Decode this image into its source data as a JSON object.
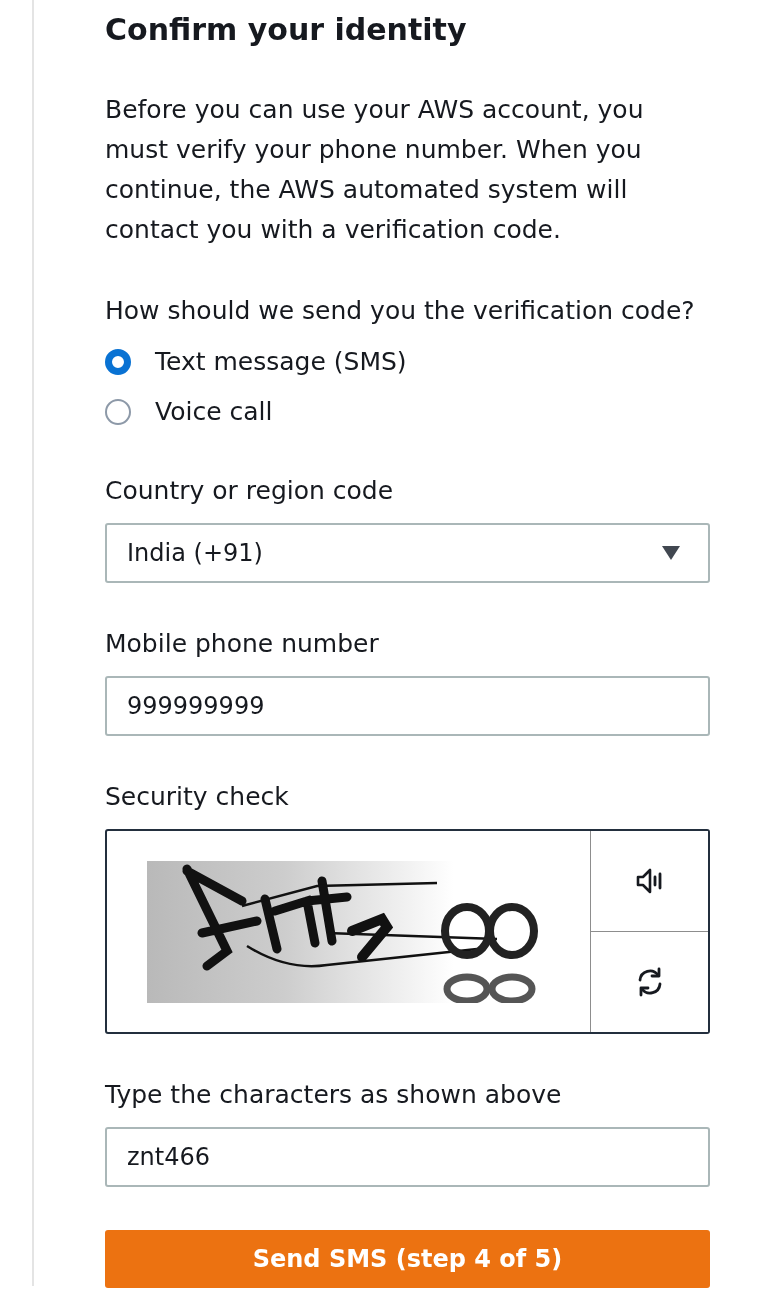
{
  "page": {
    "title": "Confirm your identity",
    "intro": "Before you can use your AWS account, you must verify your phone number. When you continue, the AWS automated system will contact you with a verification code."
  },
  "delivery": {
    "label": "How should we send you the verification code?",
    "options": [
      {
        "label": "Text message (SMS)",
        "selected": true
      },
      {
        "label": "Voice call",
        "selected": false
      }
    ]
  },
  "country": {
    "label": "Country or region code",
    "value": "India (+91)"
  },
  "phone": {
    "label": "Mobile phone number",
    "value": "999999999"
  },
  "security_check": {
    "label": "Security check"
  },
  "captcha_answer": {
    "label": "Type the characters as shown above",
    "value": "znt466"
  },
  "submit_button": {
    "label": "Send SMS (step 4 of 5)"
  }
}
